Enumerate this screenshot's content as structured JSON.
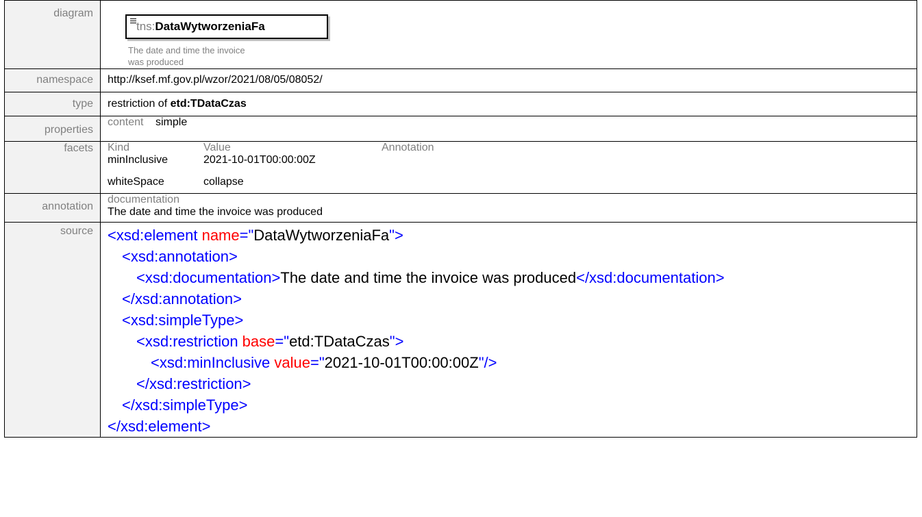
{
  "labels": {
    "diagram": "diagram",
    "namespace": "namespace",
    "type": "type",
    "properties": "properties",
    "facets": "facets",
    "annotation": "annotation",
    "source": "source"
  },
  "diagram": {
    "prefix": "tns:",
    "name": "DataWytworzeniaFa",
    "doc_line1": "The date and time the invoice",
    "doc_line2": "was produced"
  },
  "namespace": "http://ksef.mf.gov.pl/wzor/2021/08/05/08052/",
  "type": {
    "prefix": "restriction of ",
    "base": "etd:TDataCzas"
  },
  "properties": {
    "key": "content",
    "value": "simple"
  },
  "facets": {
    "headers": [
      "Kind",
      "Value",
      "Annotation"
    ],
    "rows": [
      {
        "kind": "minInclusive",
        "value": "2021-10-01T00:00:00Z",
        "annotation": ""
      },
      {
        "kind": "whiteSpace",
        "value": "collapse",
        "annotation": ""
      }
    ]
  },
  "annotation": {
    "head": "documentation",
    "text": "The date and time the invoice was produced"
  },
  "source": {
    "l1_open": "<xsd:element",
    "l1_attr": " name",
    "l1_eq": "=\"",
    "l1_val": "DataWytworzeniaFa",
    "l1_close": "\">",
    "l2": "<xsd:annotation>",
    "l3_open": "<xsd:documentation>",
    "l3_text": "The date and time the invoice was produced",
    "l3_close": "</xsd:documentation>",
    "l4": "</xsd:annotation>",
    "l5": "<xsd:simpleType>",
    "l6_open": "<xsd:restriction",
    "l6_attr": " base",
    "l6_eq": "=\"",
    "l6_val": "etd:TDataCzas",
    "l6_close": "\">",
    "l7_open": "<xsd:minInclusive",
    "l7_attr": " value",
    "l7_eq": "=\"",
    "l7_val": "2021-10-01T00:00:00Z",
    "l7_close": "\"/>",
    "l8": "</xsd:restriction>",
    "l9": "</xsd:simpleType>",
    "l10": "</xsd:element>"
  }
}
